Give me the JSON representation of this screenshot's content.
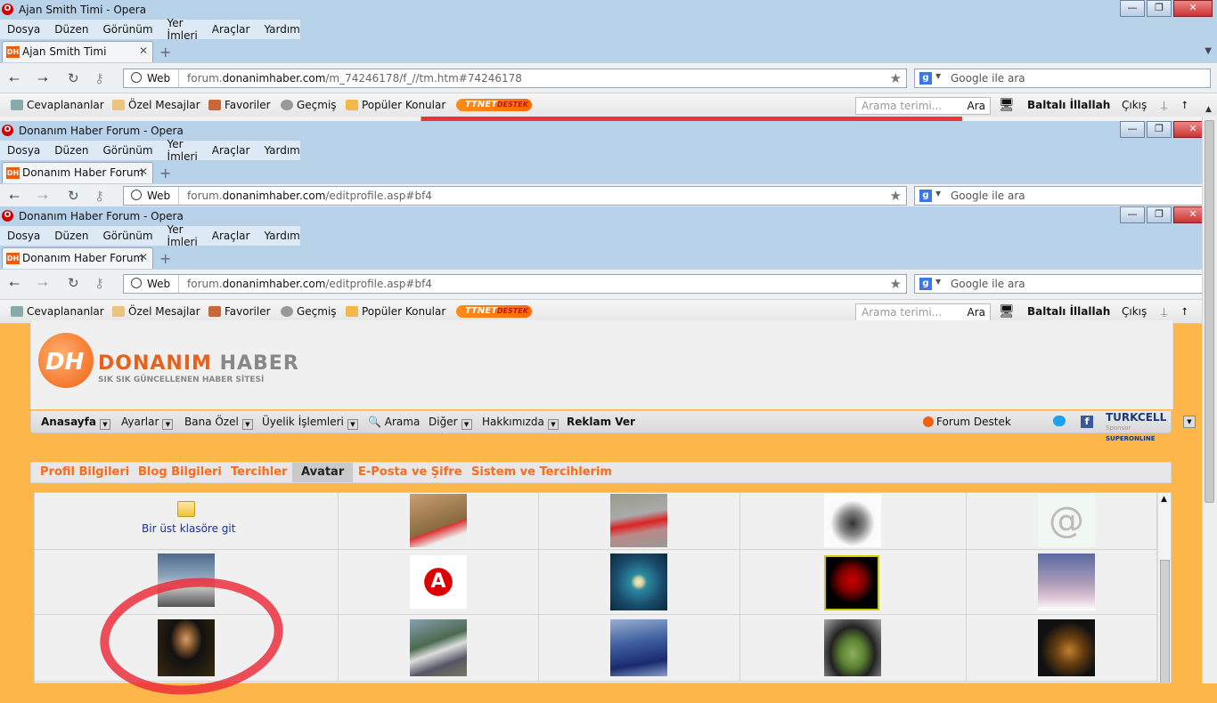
{
  "windows": [
    {
      "title": "Ajan Smith Timi - Opera",
      "tab_label": "Ajan Smith Timi",
      "url_prefix": "forum.",
      "url_domain": "donanimhaber.com",
      "url_path": "/m_74246178/f_//tm.htm#74246178"
    },
    {
      "title": "Donanım Haber Forum - Opera",
      "tab_label": "Donanım Haber Forum",
      "url_prefix": "forum.",
      "url_domain": "donanimhaber.com",
      "url_path": "/editprofile.asp#bf4"
    },
    {
      "title": "Donanım Haber Forum - Opera",
      "tab_label": "Donanım Haber Forum",
      "url_prefix": "forum.",
      "url_domain": "donanimhaber.com",
      "url_path": "/editprofile.asp#bf4"
    }
  ],
  "menu": [
    "Dosya",
    "Düzen",
    "Görünüm",
    "Yer İmleri",
    "Araçlar",
    "Yardım"
  ],
  "web_chip": "Web",
  "google_placeholder": "Google ile ara",
  "bookmarks": {
    "cevaplananlar": "Cevaplananlar",
    "ozel_mesajlar": "Özel Mesajlar",
    "favoriler": "Favoriler",
    "gecmis": "Geçmiş",
    "populer": "Popüler Konular",
    "ttnet": "TTNET",
    "ttnet_sub": "DESTEK",
    "search_placeholder": "Arama terimi...",
    "search_button": "Ara",
    "user": "Baltalı İllallah",
    "logout": "Çıkış"
  },
  "site": {
    "logo_dh": "DH",
    "logo_word1": "DONANIM",
    "logo_word2": "HABER",
    "logo_sub": "SIK SIK GÜNCELLENEN HABER SİTESİ"
  },
  "mainnav": {
    "anasayfa": "Anasayfa",
    "ayarlar": "Ayarlar",
    "bana_ozel": "Bana Özel",
    "uyelik": "Üyelik İşlemleri",
    "arama": "Arama",
    "diger": "Diğer",
    "hakkimizda": "Hakkımızda",
    "reklam": "Reklam Ver",
    "forum_destek": "Forum Destek",
    "turkcell": "TURKCELL",
    "sponsor": "Sponsor",
    "superonline": "SUPERONLINE"
  },
  "profile_tabs": [
    "Profil Bilgileri",
    "Blog Bilgileri",
    "Tercihler",
    "Avatar",
    "E-Posta ve Şifre",
    "Sistem ve Tercihlerim"
  ],
  "active_profile_tab": "Avatar",
  "avatar_grid": {
    "up_folder_label": "Bir üst klasöre git"
  },
  "colors": {
    "page_bg": "#fcb64a",
    "brand_orange": "#ff6a1a",
    "titlebar": "#b8d2ea",
    "annotation_red": "#eb2837"
  }
}
